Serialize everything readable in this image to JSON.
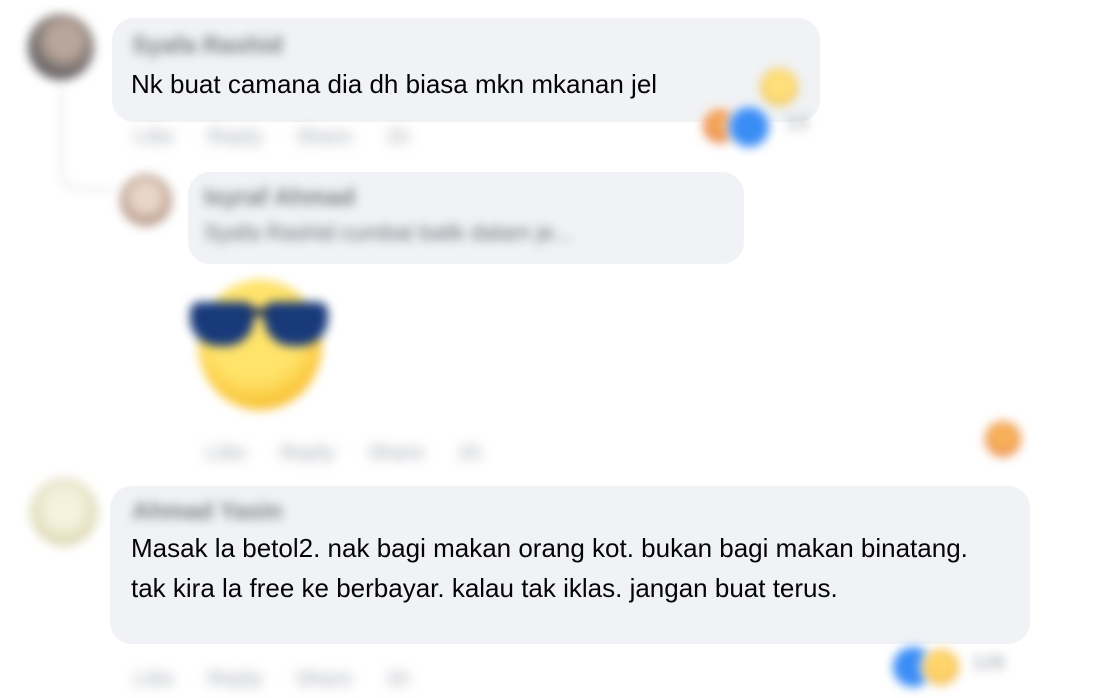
{
  "comments": [
    {
      "author": "Syafa Rashid",
      "text": "Nk buat camana dia dh biasa mkn mkanan jel",
      "actions": [
        "Like",
        "Reply",
        "Share",
        "1h"
      ],
      "reaction_count": "13"
    },
    {
      "author": "Isyraf Ahmad",
      "reply_preview": "Syafa Rashid cumbat balik dalam je...",
      "sticker": "sunglasses-emoji",
      "actions": [
        "Like",
        "Reply",
        "Share",
        "1h"
      ]
    },
    {
      "author": "Ahmad Yasin",
      "text": "Masak la betol2. nak bagi makan orang kot. bukan bagi makan binatang. tak kira la free ke berbayar. kalau tak iklas. jangan buat terus.",
      "actions": [
        "Like",
        "Reply",
        "Share",
        "1h"
      ],
      "reaction_count": "126"
    }
  ],
  "icons": {
    "like": "like-icon",
    "haha": "haha-icon",
    "angry": "angry-icon"
  },
  "colors": {
    "bubble": "#f0f2f5",
    "like_blue": "#3b8df6",
    "emoji_yellow": "#f7c531"
  }
}
